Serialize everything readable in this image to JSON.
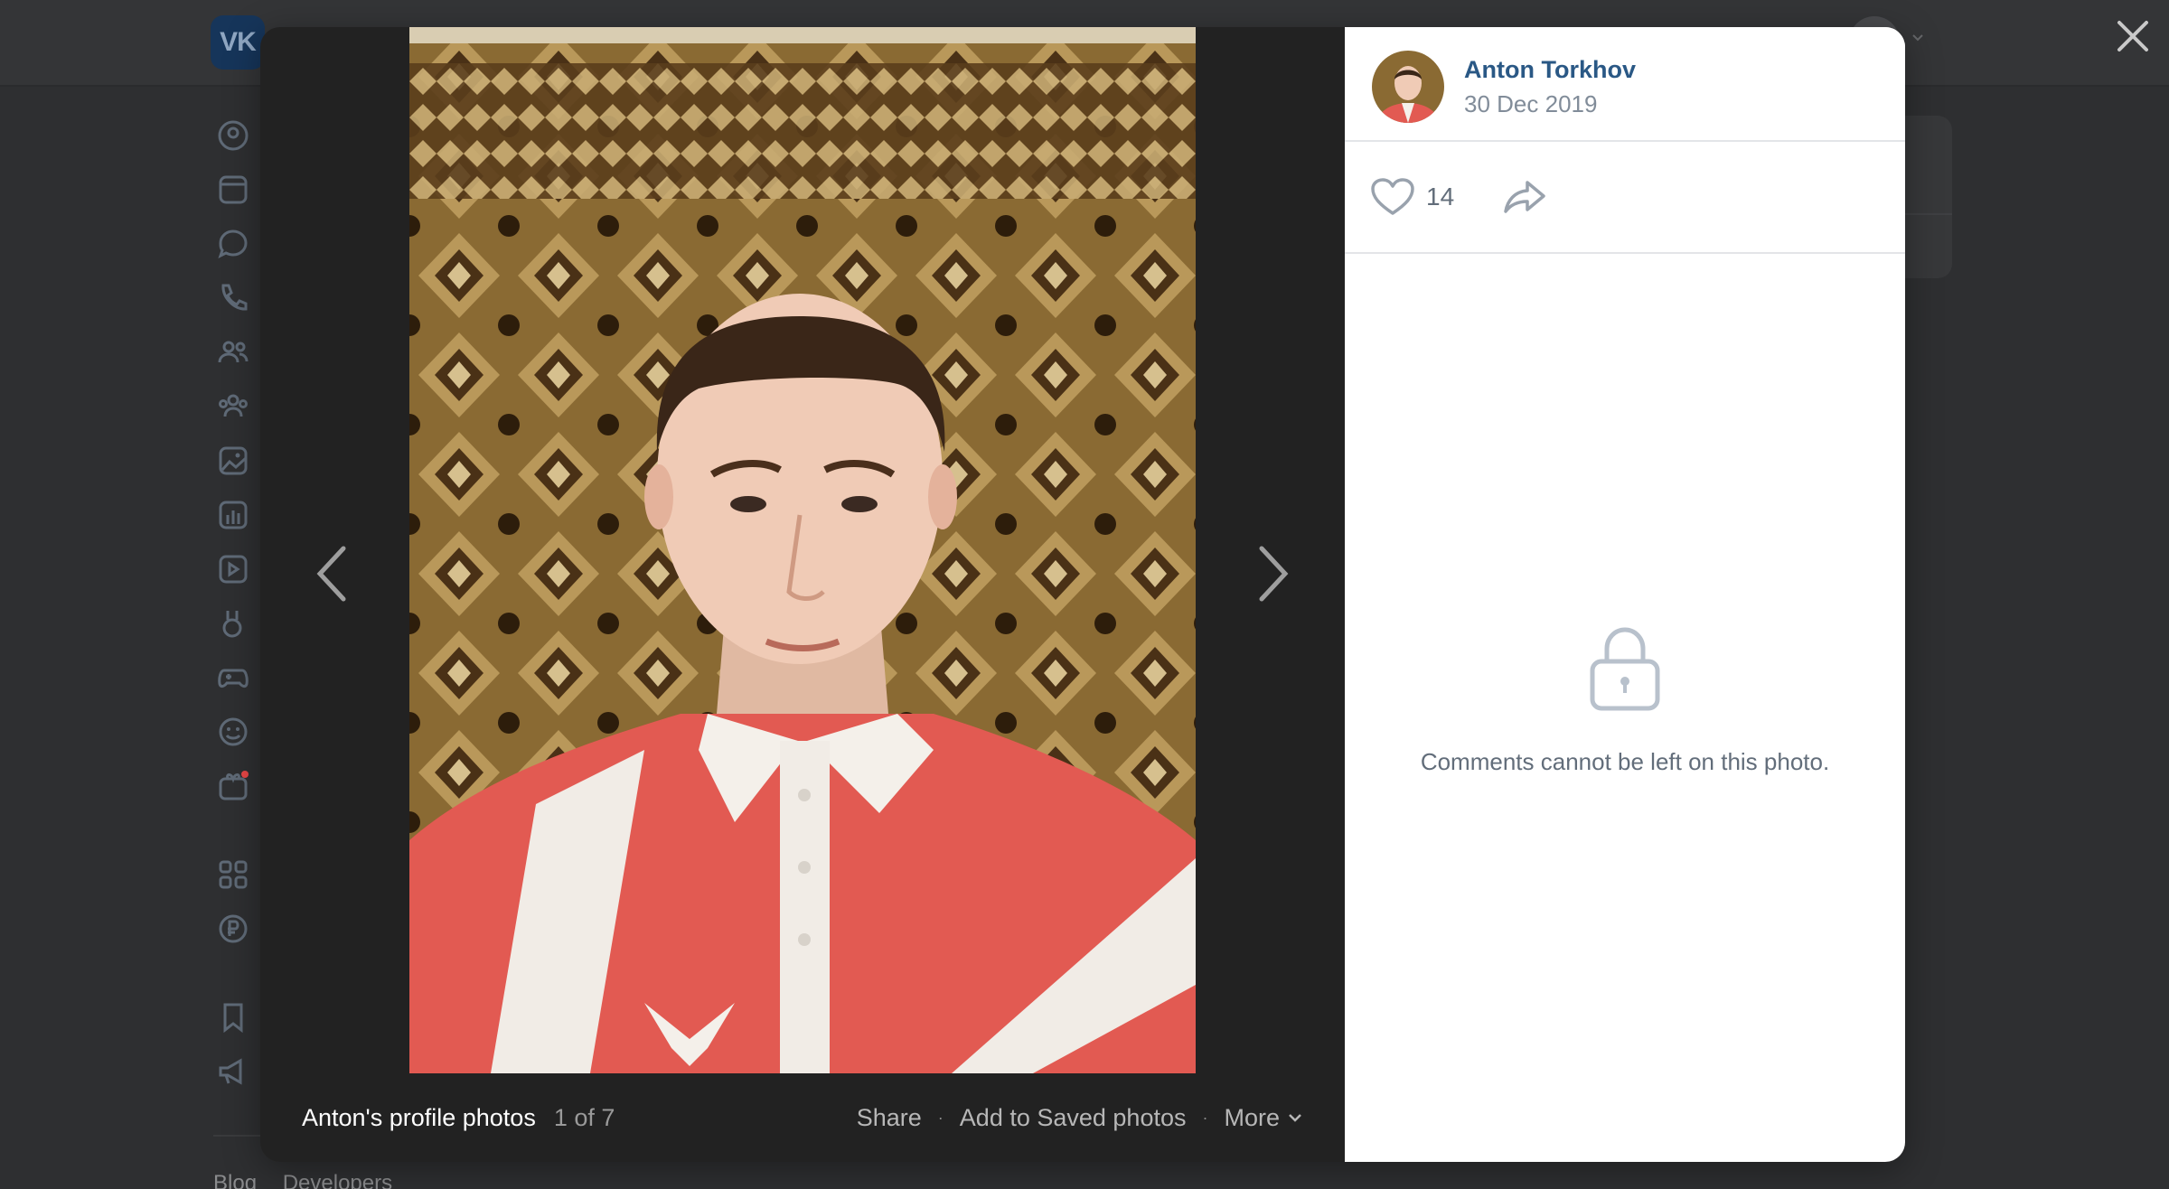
{
  "app": {
    "logo_text": "VK"
  },
  "footer": {
    "links": [
      "Blog",
      "Developers"
    ]
  },
  "viewer": {
    "album_title": "Anton's profile photos",
    "counter": "1 of 7",
    "actions": {
      "share": "Share",
      "save": "Add to Saved photos",
      "more": "More"
    },
    "sep": "·"
  },
  "post": {
    "author_name": "Anton Torkhov",
    "date": "30 Dec 2019",
    "likes": "14",
    "comments_locked_text": "Comments cannot be left on this photo."
  },
  "colors": {
    "link": "#2a5885",
    "muted": "#818c99",
    "shirt_red": "#e25a52",
    "carpet": "#8a6a33"
  },
  "icons": {
    "nav": [
      "profile-icon",
      "news-icon",
      "messages-icon",
      "calls-icon",
      "friends-icon",
      "communities-icon",
      "photos-icon",
      "music-icon",
      "video-icon",
      "clips-icon",
      "games-icon",
      "stickers-icon",
      "gifts-icon",
      "apps-icon",
      "pay-icon",
      "bookmarks-icon",
      "ads-icon"
    ]
  }
}
